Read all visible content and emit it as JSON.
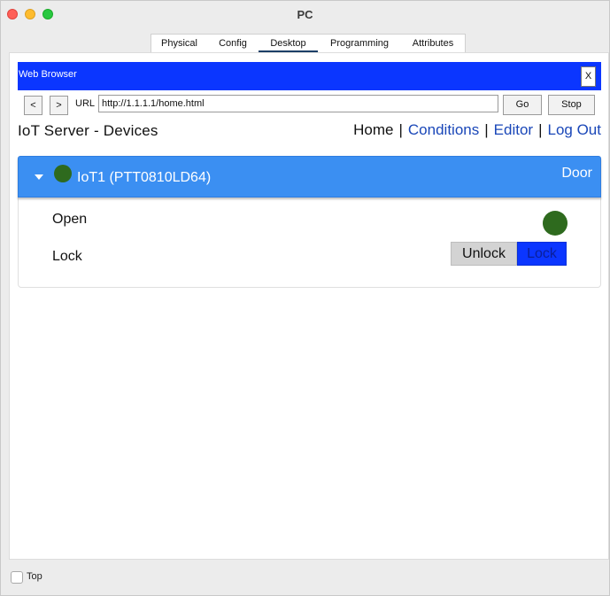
{
  "window": {
    "title": "PC"
  },
  "tabs": [
    {
      "label": "Physical"
    },
    {
      "label": "Config"
    },
    {
      "label": "Desktop",
      "active": true
    },
    {
      "label": "Programming"
    },
    {
      "label": "Attributes"
    }
  ],
  "browser": {
    "title": "Web Browser",
    "close_label": "X",
    "back_label": "<",
    "forward_label": ">",
    "url_label": "URL",
    "url_value": "http://1.1.1.1/home.html",
    "go_label": "Go",
    "stop_label": "Stop",
    "header_color": "#0b36ff"
  },
  "page": {
    "heading": "IoT Server - Devices",
    "nav": {
      "home": "Home",
      "conditions": "Conditions",
      "editor": "Editor",
      "logout": "Log Out",
      "separator": "|"
    }
  },
  "device": {
    "name": "IoT1 (PTT0810LD64)",
    "type": "Door",
    "status_color": "#2e6a1e",
    "header_color": "#3b8ff2",
    "rows": {
      "open_label": "Open",
      "open_state_color": "#2e6a1e",
      "lock_label": "Lock",
      "unlock_option": "Unlock",
      "lock_option": "Lock",
      "selected_option": "Lock"
    }
  },
  "footer": {
    "top_label": "Top",
    "top_checked": false
  }
}
